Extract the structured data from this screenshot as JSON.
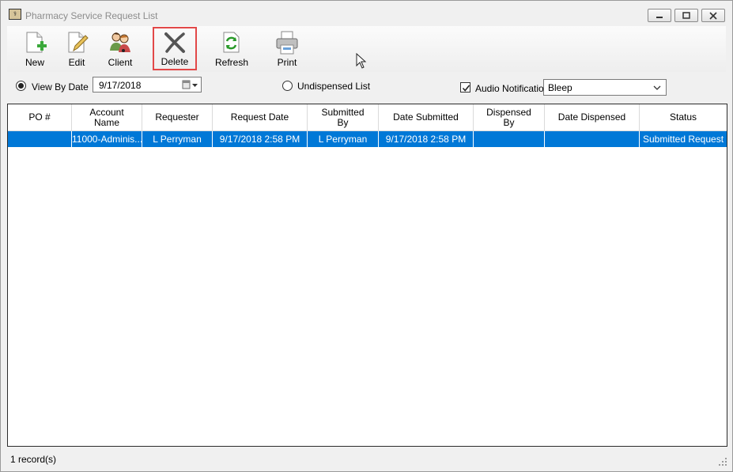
{
  "window": {
    "title": "Pharmacy Service Request List"
  },
  "toolbar": {
    "new_label": "New",
    "edit_label": "Edit",
    "client_label": "Client",
    "delete_label": "Delete",
    "refresh_label": "Refresh",
    "print_label": "Print"
  },
  "filter": {
    "view_by_date_label": "View By Date",
    "view_by_date_selected": true,
    "date_value": "9/17/2018",
    "undispensed_label": "Undispensed List",
    "undispensed_selected": false,
    "audio_label": "Audio Notification",
    "audio_checked": true,
    "audio_value": "Bleep"
  },
  "grid": {
    "columns": [
      "PO #",
      "Account\nName",
      "Requester",
      "Request Date",
      "Submitted\nBy",
      "Date Submitted",
      "Dispensed\nBy",
      "Date Dispensed",
      "Status"
    ],
    "rows": [
      [
        "",
        "11000-Adminis...",
        "L Perryman",
        "9/17/2018 2:58 PM",
        "L Perryman",
        "9/17/2018 2:58 PM",
        "",
        "",
        "Submitted Request"
      ]
    ],
    "selected_color": "#0078d7"
  },
  "status": {
    "text": "1 record(s)"
  },
  "colors": {
    "highlight_border": "#e24848"
  }
}
